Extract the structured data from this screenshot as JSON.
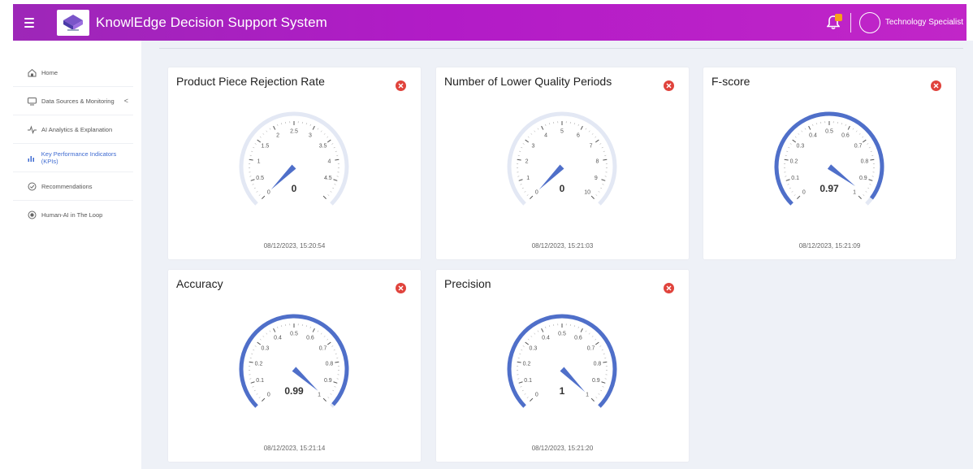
{
  "header": {
    "title": "KnowlEdge Decision Support System",
    "user": "Technology Specialist"
  },
  "sidebar": {
    "items": [
      {
        "label": "Home",
        "icon": "home-icon"
      },
      {
        "label": "Data Sources & Monitoring",
        "icon": "monitor-icon",
        "chevron": "<"
      },
      {
        "label": "AI Analytics & Explanation",
        "icon": "pulse-icon"
      },
      {
        "label": "Key Performance Indicators (KPIs)",
        "icon": "bar-chart-icon",
        "active": true
      },
      {
        "label": "Recommendations",
        "icon": "check-circle-icon"
      },
      {
        "label": "Human-AI in The Loop",
        "icon": "target-icon"
      }
    ]
  },
  "cards": [
    {
      "title": "Product Piece Rejection Rate",
      "value": "0",
      "timestamp": "08/12/2023, 15:20:54",
      "min": 0,
      "max": 5,
      "current": 0,
      "ticks": [
        "0",
        "0.5",
        "1",
        "1.5",
        "2",
        "2.5",
        "3",
        "3.5",
        "4",
        "4.5",
        "5"
      ],
      "tick_label_mask": [
        true,
        true,
        true,
        true,
        true,
        true,
        true,
        true,
        true,
        true,
        false
      ]
    },
    {
      "title": "Number of Lower Quality Periods",
      "value": "0",
      "timestamp": "08/12/2023, 15:21:03",
      "min": 0,
      "max": 10,
      "current": 0,
      "ticks": [
        "0",
        "1",
        "2",
        "3",
        "4",
        "5",
        "6",
        "7",
        "8",
        "9",
        "10"
      ]
    },
    {
      "title": "F-score",
      "value": "0.97",
      "timestamp": "08/12/2023, 15:21:09",
      "min": 0,
      "max": 1,
      "current": 0.97,
      "ticks": [
        "0",
        "0.1",
        "0.2",
        "0.3",
        "0.4",
        "0.5",
        "0.6",
        "0.7",
        "0.8",
        "0.9",
        "1"
      ]
    },
    {
      "title": "Accuracy",
      "value": "0.99",
      "timestamp": "08/12/2023, 15:21:14",
      "min": 0,
      "max": 1,
      "current": 0.99,
      "ticks": [
        "0",
        "0.1",
        "0.2",
        "0.3",
        "0.4",
        "0.5",
        "0.6",
        "0.7",
        "0.8",
        "0.9",
        "1"
      ]
    },
    {
      "title": "Precision",
      "value": "1",
      "timestamp": "08/12/2023, 15:21:20",
      "min": 0,
      "max": 1,
      "current": 1,
      "ticks": [
        "0",
        "0.1",
        "0.2",
        "0.3",
        "0.4",
        "0.5",
        "0.6",
        "0.7",
        "0.8",
        "0.9",
        "1"
      ]
    }
  ],
  "colors": {
    "gauge_fill": "#4f6fc9",
    "gauge_track": "#e3e8f4",
    "close": "#e0433c",
    "accent": "#3f6bd1"
  }
}
